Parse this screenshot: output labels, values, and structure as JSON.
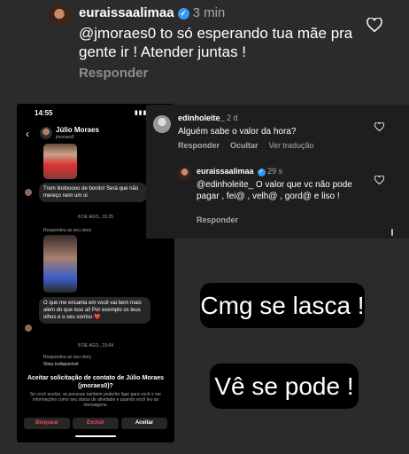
{
  "top_comment": {
    "username": "euraissaalimaa",
    "time": "3 min",
    "text": "@jmoraes0 to só esperando tua mãe pra gente ir ! Atender juntas !",
    "reply": "Responder",
    "verified_icon": "verified-badge-icon",
    "like_icon": "heart-icon"
  },
  "phone": {
    "status_time": "14:55",
    "status_icons": "▮▮▮ ◠ ▭",
    "back_icon": "‹",
    "contact_name": "Júlio Moraes",
    "contact_handle": "jmoraes0",
    "messages": [
      "Trem lindooooo de bonito! Será que não mereço nem um oi",
      "O que me encanta em você vai bem mais além do que isso ai! Por exemplo os teus olhos e o seu sorriso ❤️"
    ],
    "dates": [
      "8 DE AGO., 15:25",
      "8 DE AGO., 23:04"
    ],
    "story_reply_label": "Respondeu ao seu story",
    "story_reply_label_2": "Respondeu ao seu story",
    "story_unavailable": "Story indisponível",
    "accept_title": "Aceitar solicitação de contato de Júlio Moraes (jmoraes0)?",
    "accept_desc": "Se você aceitar, as pessoas também poderão ligar para você e ver informações como seu status de atividade e quando você leu as mensagens.",
    "buttons": {
      "block": "Bloquear",
      "delete": "Excluir",
      "accept": "Aceitar"
    },
    "colors": {
      "block": "#ed4956",
      "delete": "#ed4956",
      "accept": "#ffffff"
    }
  },
  "overlay": {
    "comment1": {
      "username": "edinholeite_",
      "time": "2 d",
      "text": "Alguém sabe o valor da hora?",
      "actions": [
        "Responder",
        "Ocultar",
        "Ver tradução"
      ]
    },
    "comment2": {
      "username": "euraissaalimaa",
      "time": "29 s",
      "text": "@edinholeite_ O valor que vc não pode pagar , fei@ , velh@ , gord@ e liso !",
      "actions": [
        "Responder"
      ]
    }
  },
  "stickers": {
    "sticker1": "Cmg se lasca !",
    "sticker2": "Vê se pode !"
  },
  "colors": {
    "background": "#2b2b2b",
    "verified": "#3897f0",
    "muted": "#8e8e8e"
  }
}
